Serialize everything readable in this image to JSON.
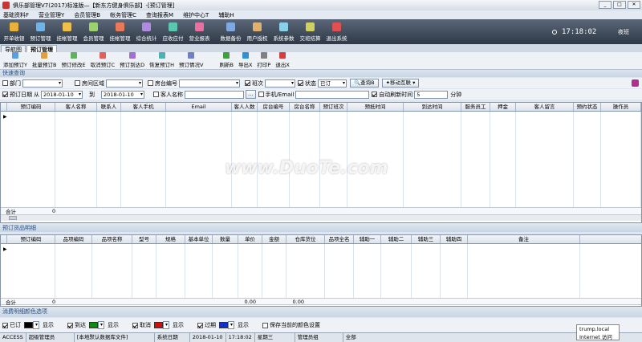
{
  "window": {
    "title": "俱乐部管理V7(2017)标准版—【新东方健身俱乐部】-[预订管理]"
  },
  "menu": [
    "基础资料F",
    "营业管理Y",
    "会员管理B",
    "帐务管理C",
    "查询报表M",
    "维护中心T",
    "辅助H"
  ],
  "toolbar": {
    "buttons": [
      {
        "label": "开单收银",
        "color": "#e8b23a"
      },
      {
        "label": "预订管理",
        "color": "#6fb3e8"
      },
      {
        "label": "挂帐管理",
        "color": "#f0c04a"
      },
      {
        "label": "会员管理",
        "color": "#9ad36a"
      },
      {
        "label": "挂帐管理",
        "color": "#e87a5a"
      },
      {
        "label": "综合统计",
        "color": "#b08ae0"
      },
      {
        "label": "应收应付",
        "color": "#5ac7b0"
      },
      {
        "label": "营业报表",
        "color": "#e86fa0"
      },
      {
        "label": "数据备份",
        "color": "#7fa8e0"
      },
      {
        "label": "用户授权",
        "color": "#e0b070"
      },
      {
        "label": "系统参数",
        "color": "#8ad0e8"
      },
      {
        "label": "交班结算",
        "color": "#d0d060"
      },
      {
        "label": "退出系统",
        "color": "#e05050"
      }
    ],
    "clock": "17:18:02",
    "shift": "夜班"
  },
  "tabs": [
    "导航图",
    "预订管理"
  ],
  "toolbar2": {
    "buttons": [
      {
        "label": "添加预订Y",
        "color": "#5a9ee0"
      },
      {
        "label": "批量预订B",
        "color": "#e0a040"
      },
      {
        "label": "预订修改E",
        "color": "#60b060"
      },
      {
        "label": "取消预订C",
        "color": "#e06060"
      },
      {
        "label": "预订到达D",
        "color": "#a070d0"
      },
      {
        "label": "恢复预订H",
        "color": "#50b0b0"
      },
      {
        "label": "预订情况V",
        "color": "#7080c0"
      },
      {
        "label": "刷新B",
        "color": "#40a040"
      },
      {
        "label": "导出X",
        "color": "#3090d0"
      },
      {
        "label": "打印P",
        "color": "#808080"
      },
      {
        "label": "退出X",
        "color": "#d04040"
      }
    ]
  },
  "query": {
    "header": "快速查询",
    "row1": {
      "dept": "部门",
      "area": "房间区域",
      "room_no": "房台编号",
      "shift": "班次",
      "status": "状态",
      "status_value": "已订",
      "query_btn": "查询B",
      "mobile_btn": "移动互联"
    },
    "row2": {
      "date_label": "预订日期",
      "from": "从",
      "from_value": "2018-01-10",
      "to": "到",
      "to_value": "2018-01-10",
      "customer": "客人名称",
      "phone": "手机/Email",
      "auto_refresh": "自动刷新时间",
      "refresh_value": "5",
      "minutes": "分钟"
    }
  },
  "grid1": {
    "columns": [
      {
        "label": "预订编码",
        "w": 60
      },
      {
        "label": "客人名称",
        "w": 52
      },
      {
        "label": "联系人",
        "w": 30
      },
      {
        "label": "客人手机",
        "w": 56
      },
      {
        "label": "Email",
        "w": 82
      },
      {
        "label": "客人人数",
        "w": 32
      },
      {
        "label": "房台编号",
        "w": 40
      },
      {
        "label": "房台名称",
        "w": 38
      },
      {
        "label": "预订班次",
        "w": 34
      },
      {
        "label": "预抵时间",
        "w": 70
      },
      {
        "label": "到达时间",
        "w": 72
      },
      {
        "label": "服务员工",
        "w": 36
      },
      {
        "label": "押金",
        "w": 32
      },
      {
        "label": "客人留言",
        "w": 72
      },
      {
        "label": "预约状态",
        "w": 34
      },
      {
        "label": "操作员",
        "w": 50
      }
    ],
    "sum_label": "合计",
    "sum_value": "0"
  },
  "detail_header": "预订货品明细",
  "grid2": {
    "columns": [
      {
        "label": "预订编码",
        "w": 60
      },
      {
        "label": "品项编码",
        "w": 46
      },
      {
        "label": "品项名称",
        "w": 50
      },
      {
        "label": "型号",
        "w": 30
      },
      {
        "label": "规格",
        "w": 36
      },
      {
        "label": "基本单位",
        "w": 34
      },
      {
        "label": "数量",
        "w": 32
      },
      {
        "label": "单价",
        "w": 30
      },
      {
        "label": "金额",
        "w": 30
      },
      {
        "label": "仓库货位",
        "w": 48
      },
      {
        "label": "品项全名",
        "w": 36
      },
      {
        "label": "辅助一",
        "w": 34
      },
      {
        "label": "辅助二",
        "w": 38
      },
      {
        "label": "辅助三",
        "w": 36
      },
      {
        "label": "辅助四",
        "w": 34
      },
      {
        "label": "备注",
        "w": 140
      }
    ],
    "sum_label": "合计",
    "sum_value1": "0",
    "sum_qty": "0.00",
    "sum_amount": "0.00"
  },
  "legend": {
    "header": "消费明细颜色选项",
    "items": [
      {
        "label": "已订",
        "color": "#000000",
        "show": "显示"
      },
      {
        "label": "到达",
        "color": "#118a11",
        "show": "显示"
      },
      {
        "label": "取消",
        "color": "#d01010",
        "show": "显示"
      },
      {
        "label": "过期",
        "color": "#1030d0",
        "show": "显示"
      }
    ],
    "save_label": "保存当前的颜色设置"
  },
  "statusbar": [
    "ACCESS",
    "超级管理员",
    "[本地默认数据库文件]",
    "系统日期",
    "2018-01-10",
    "17:18:02",
    "星期三",
    "管理员组",
    "全部"
  ],
  "tooltip": {
    "line1": "trump.local",
    "line2": "Internet 访问"
  },
  "watermark": "www.DuoTe.com"
}
